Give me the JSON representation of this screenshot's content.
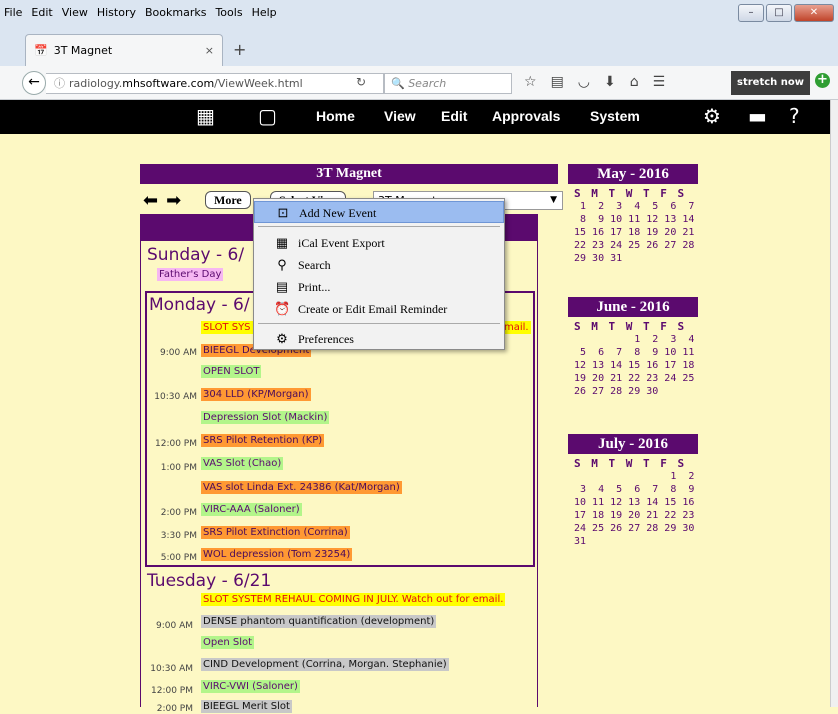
{
  "menubar": {
    "items": [
      "File",
      "Edit",
      "View",
      "History",
      "Bookmarks",
      "Tools",
      "Help"
    ]
  },
  "tab": {
    "title": "3T Magnet",
    "close": "×",
    "new": "+"
  },
  "nav": {
    "url_prefix": "radiology.",
    "url_domain": "mhsoftware.com",
    "url_path": "/ViewWeek.html",
    "search_placeholder": "Search",
    "stretch": "stretch now"
  },
  "appbar": {
    "home": "Home",
    "view": "View",
    "edit": "Edit",
    "approvals": "Approvals",
    "system": "System"
  },
  "panel": {
    "title": "3T Magnet",
    "more": "More",
    "select_view": "Select View",
    "select_value": "3T Magnet"
  },
  "context_menu": {
    "items": [
      "Add New Event",
      "iCal Event Export",
      "Search",
      "Print...",
      "Create or Edit Email Reminder",
      "Preferences"
    ]
  },
  "days": {
    "sunday": {
      "title": "Sunday - 6/",
      "holiday": "Father's Day"
    },
    "monday": {
      "title": "Monday - 6/",
      "events": [
        {
          "time": "",
          "text": "SLOT SYS",
          "tail": "mail."
        },
        {
          "time": "9:00 AM",
          "text": "BIEEGL Development"
        },
        {
          "time": "",
          "text": "OPEN SLOT"
        },
        {
          "time": "10:30 AM",
          "text": "304 LLD (KP/Morgan)"
        },
        {
          "time": "",
          "text": "Depression Slot (Mackin)"
        },
        {
          "time": "12:00 PM",
          "text": "SRS Pilot Retention (KP)"
        },
        {
          "time": "1:00 PM",
          "text": "VAS Slot (Chao)"
        },
        {
          "time": "",
          "text": "VAS slot Linda Ext. 24386 (Kat/Morgan)"
        },
        {
          "time": "2:00 PM",
          "text": "VIRC-AAA (Saloner)"
        },
        {
          "time": "3:30 PM",
          "text": "SRS Pilot Extinction (Corrina)"
        },
        {
          "time": "5:00 PM",
          "text": "WOL depression (Tom 23254)"
        }
      ]
    },
    "tuesday": {
      "title": "Tuesday - 6/21",
      "events": [
        {
          "time": "",
          "text": "SLOT SYSTEM REHAUL COMING IN JULY. Watch out for email."
        },
        {
          "time": "9:00 AM",
          "text": "DENSE phantom quantification (development)"
        },
        {
          "time": "",
          "text": "Open Slot"
        },
        {
          "time": "10:30 AM",
          "text": "CIND Development (Corrina, Morgan. Stephanie)"
        },
        {
          "time": "12:00 PM",
          "text": "VIRC-VWI (Saloner)"
        },
        {
          "time": "2:00 PM",
          "text": "BIEEGL Merit Slot"
        }
      ]
    }
  },
  "calendars": [
    {
      "title": "May - 2016",
      "weekdays": "S M T W T F S",
      "weeks": [
        " 1  2  3  4  5  6  7",
        " 8  9 10 11 12 13 14",
        "15 16 17 18 19 20 21",
        "22 23 24 25 26 27 28",
        "29 30 31"
      ]
    },
    {
      "title": "June - 2016",
      "weekdays": "S M T W T F S",
      "weeks": [
        "          1  2  3  4",
        " 5  6  7  8  9 10 11",
        "12 13 14 15 16 17 18",
        "19 20 21 22 23 24 25",
        "26 27 28 29 30"
      ]
    },
    {
      "title": "July - 2016",
      "weekdays": "S M T W T F S",
      "weeks": [
        "                1  2",
        " 3  4  5  6  7  8  9",
        "10 11 12 13 14 15 16",
        "17 18 19 20 21 22 23",
        "24 25 26 27 28 29 30",
        "31"
      ]
    }
  ]
}
